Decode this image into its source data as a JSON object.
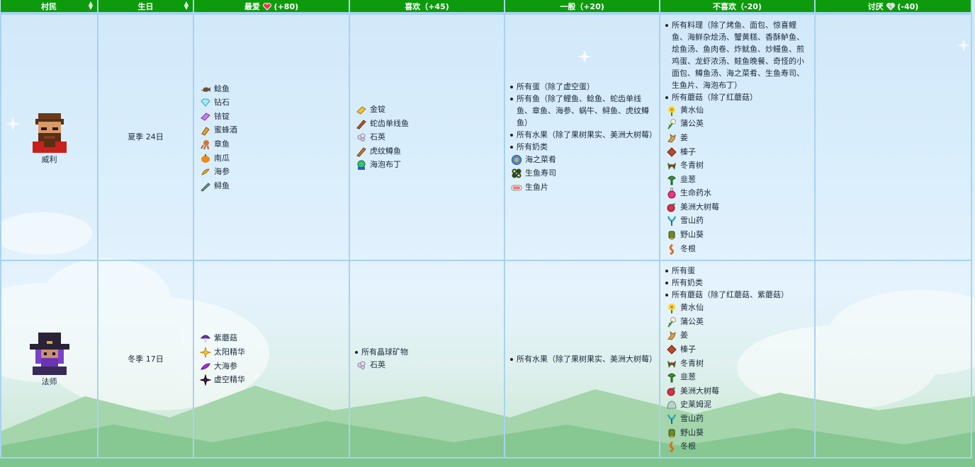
{
  "headers": {
    "villager": "村民",
    "birthday": "生日",
    "love": "最爱",
    "love_pts": "(+80)",
    "like": "喜欢（+45)",
    "neutral": "一般（+20)",
    "dislike": "不喜欢（-20)",
    "hate": "讨厌",
    "hate_pts": "(-40)"
  },
  "colors": {
    "header_green": "#0d9b0d",
    "grid_blue": "#a7d3f0",
    "text": "#1c2a3a"
  },
  "rows": [
    {
      "villager": "威利",
      "birthday": "夏季 24日",
      "love": [
        {
          "icon": "catfish-icon",
          "label": "鲶鱼"
        },
        {
          "icon": "diamond-icon",
          "label": "钻石"
        },
        {
          "icon": "iridium-bar-icon",
          "label": "铱锭"
        },
        {
          "icon": "mead-icon",
          "label": "蜜蜂酒"
        },
        {
          "icon": "octopus-icon",
          "label": "章鱼"
        },
        {
          "icon": "pumpkin-icon",
          "label": "南瓜"
        },
        {
          "icon": "sea-cucumber-icon",
          "label": "海参"
        },
        {
          "icon": "sturgeon-icon",
          "label": "鲟鱼"
        }
      ],
      "like": [
        {
          "icon": "gold-bar-icon",
          "label": "金锭"
        },
        {
          "icon": "lingcod-icon",
          "label": "蛇齿单线鱼"
        },
        {
          "icon": "quartz-icon",
          "label": "石英"
        },
        {
          "icon": "tiger-trout-icon",
          "label": "虎纹鳟鱼"
        },
        {
          "icon": "sea-pudding-icon",
          "label": "海泡布丁"
        }
      ],
      "neutral": {
        "bullets": [
          "所有蛋（除了虚空蛋）",
          "所有鱼（除了鲤鱼、鲶鱼、蛇齿单线鱼、章鱼、海参、蜗牛、鲟鱼、虎纹鳟鱼）",
          "所有水果（除了果树果实、美洲大树莓）",
          "所有奶类"
        ],
        "items": [
          {
            "icon": "dish-o-the-sea-icon",
            "label": "海之菜肴"
          },
          {
            "icon": "maki-roll-icon",
            "label": "生鱼寿司"
          },
          {
            "icon": "sashimi-icon",
            "label": "生鱼片"
          }
        ]
      },
      "dislike": {
        "bullets": [
          "所有料理（除了烤鱼、面包、惊喜鲤鱼、海鲜杂烩汤、蟹黄糕、香酥鲈鱼、烩鱼汤、鱼肉卷、炸鱿鱼、炒鳗鱼、煎鸡蛋、龙虾浓汤、鲑鱼晚餐、奇怪的小面包、鳟鱼汤、海之菜肴、生鱼寿司、生鱼片、海泡布丁）",
          "所有蘑菇（除了红蘑菇）"
        ],
        "items": [
          {
            "icon": "daffodil-icon",
            "label": "黄水仙"
          },
          {
            "icon": "dandelion-icon",
            "label": "蒲公英"
          },
          {
            "icon": "ginger-icon",
            "label": "姜"
          },
          {
            "icon": "hazelnut-icon",
            "label": "榛子"
          },
          {
            "icon": "holly-icon",
            "label": "冬青树"
          },
          {
            "icon": "leek-icon",
            "label": "韭葱"
          },
          {
            "icon": "life-elixir-icon",
            "label": "生命药水"
          },
          {
            "icon": "salmonberry-icon",
            "label": "美洲大树莓"
          },
          {
            "icon": "snow-yam-icon",
            "label": "雪山药"
          },
          {
            "icon": "wild-horseradish-icon",
            "label": "野山葵"
          },
          {
            "icon": "winter-root-icon",
            "label": "冬根"
          }
        ]
      },
      "hate": []
    },
    {
      "villager": "法师",
      "birthday": "冬季 17日",
      "love": [
        {
          "icon": "purple-mushroom-icon",
          "label": "紫蘑菇"
        },
        {
          "icon": "solar-essence-icon",
          "label": "太阳精华"
        },
        {
          "icon": "super-cucumber-icon",
          "label": "大海参"
        },
        {
          "icon": "void-essence-icon",
          "label": "虚空精华"
        }
      ],
      "like": {
        "bullets": [
          "所有晶球矿物"
        ],
        "items": [
          {
            "icon": "quartz-icon",
            "label": "石英"
          }
        ]
      },
      "neutral": {
        "bullets": [
          "所有水果（除了果树果实、美洲大树莓）"
        ],
        "items": []
      },
      "dislike": {
        "bullets": [
          "所有蛋",
          "所有奶类",
          "所有蘑菇（除了红蘑菇、紫蘑菇）"
        ],
        "items": [
          {
            "icon": "daffodil-icon",
            "label": "黄水仙"
          },
          {
            "icon": "dandelion-icon",
            "label": "蒲公英"
          },
          {
            "icon": "ginger-icon",
            "label": "姜"
          },
          {
            "icon": "hazelnut-icon",
            "label": "榛子"
          },
          {
            "icon": "holly-icon",
            "label": "冬青树"
          },
          {
            "icon": "leek-icon",
            "label": "韭葱"
          },
          {
            "icon": "salmonberry-icon",
            "label": "美洲大树莓"
          },
          {
            "icon": "slime-icon",
            "label": "史莱姆泥"
          },
          {
            "icon": "snow-yam-icon",
            "label": "雪山药"
          },
          {
            "icon": "wild-horseradish-icon",
            "label": "野山葵"
          },
          {
            "icon": "winter-root-icon",
            "label": "冬根"
          }
        ]
      },
      "hate": []
    }
  ]
}
